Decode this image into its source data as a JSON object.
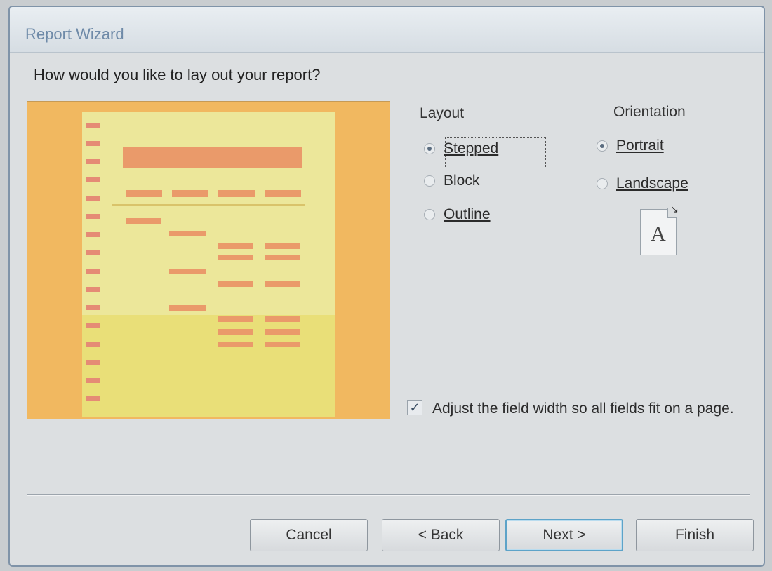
{
  "window": {
    "title": "Report Wizard"
  },
  "question": "How would you like to lay out your report?",
  "layout": {
    "label": "Layout",
    "options": [
      {
        "label": "Stepped",
        "mnemonic": "S",
        "selected": true
      },
      {
        "label": "Block",
        "mnemonic": "k",
        "selected": false
      },
      {
        "label": "Outline",
        "mnemonic": "O",
        "selected": false
      }
    ]
  },
  "orientation": {
    "label": "Orientation",
    "options": [
      {
        "label": "Portrait",
        "mnemonic": "P",
        "selected": true
      },
      {
        "label": "Landscape",
        "mnemonic": "L",
        "selected": false
      }
    ],
    "icon_letter": "A"
  },
  "adjust_width": {
    "checked": true,
    "check_glyph": "✓",
    "label": "Adjust the field width so all fields fit on a page."
  },
  "buttons": {
    "cancel": "Cancel",
    "back": "< Back",
    "next": "Next >",
    "finish": "Finish"
  },
  "colors": {
    "preview_bg": "#f1b860",
    "preview_page": "#ece79a",
    "preview_bars": "#ea9a6a",
    "title_text": "#6e8aa8",
    "default_button_border": "#5da3c8"
  }
}
